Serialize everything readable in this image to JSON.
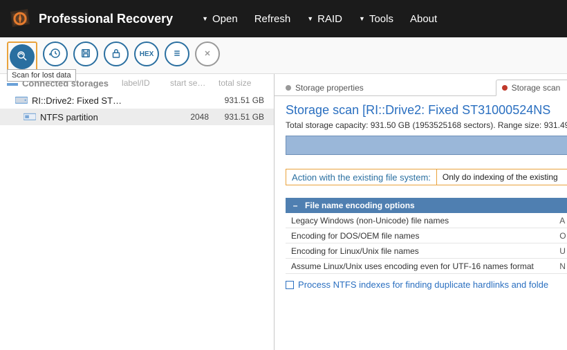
{
  "app": {
    "title": "Professional Recovery"
  },
  "menu": {
    "open": "Open",
    "refresh": "Refresh",
    "raid": "RAID",
    "tools": "Tools",
    "about": "About"
  },
  "toolbar": {
    "tooltip_scan": "Scan for lost data",
    "hex_label": "HEX"
  },
  "tree": {
    "heading": "Connected storages",
    "col_label": "label/ID",
    "col_start": "start se…",
    "col_size": "total size",
    "rows": [
      {
        "name": "RI::Drive2: Fixed ST…",
        "label": "",
        "start": "",
        "size": "931.51 GB",
        "selected": false,
        "icon": "drive"
      },
      {
        "name": "NTFS partition",
        "label": "",
        "start": "2048",
        "size": "931.51 GB",
        "selected": true,
        "icon": "part"
      }
    ]
  },
  "tabs": {
    "props": "Storage properties",
    "scan": "Storage scan "
  },
  "scan": {
    "title": "Storage scan [RI::Drive2: Fixed ST31000524NS",
    "capacity_line": "Total storage capacity: 931.50 GB (1953525168 sectors). Range size: 931.49",
    "action_label": "Action with the existing file system:",
    "action_value": "Only do indexing of the existing",
    "enc_header": "File name encoding options",
    "enc_rows": [
      {
        "label": "Legacy Windows (non-Unicode) file names",
        "val": "A"
      },
      {
        "label": "Encoding for DOS/OEM file names",
        "val": "O"
      },
      {
        "label": "Encoding for Linux/Unix file names",
        "val": "U"
      },
      {
        "label": "Assume Linux/Unix uses encoding even for UTF-16 names format",
        "val": "N"
      }
    ],
    "checkbox_label": "Process NTFS indexes for finding duplicate hardlinks and folde"
  }
}
